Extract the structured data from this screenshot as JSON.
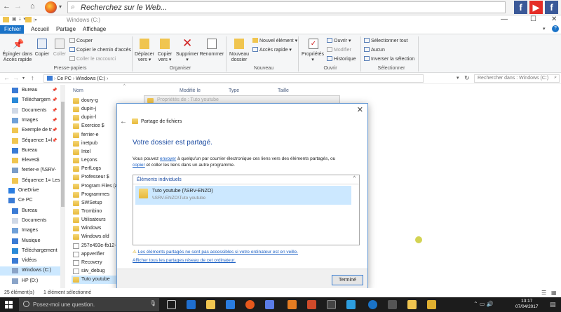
{
  "browser": {
    "search_placeholder": "Recherchez sur le Web...",
    "social": [
      {
        "icon": "facebook-icon",
        "glyph": "f",
        "color": "#3b5998"
      },
      {
        "icon": "youtube-icon",
        "glyph": "▶",
        "color": "#e52d27"
      },
      {
        "icon": "facebook-icon",
        "glyph": "f",
        "color": "#3b5998"
      }
    ]
  },
  "window": {
    "title": "Windows (C:)",
    "min": "—",
    "max": "☐",
    "close": "✕"
  },
  "tabs": [
    "Fichier",
    "Accueil",
    "Partage",
    "Affichage"
  ],
  "ribbon": {
    "pin": "Épingler dans Accès rapide",
    "copy": "Copier",
    "paste": "Coller",
    "cut": "Couper",
    "copy_path": "Copier le chemin d'accès",
    "paste_shortcut": "Coller le raccourci",
    "group_clipboard": "Presse-papiers",
    "move_to": "Déplacer vers ▾",
    "copy_to": "Copier vers ▾",
    "delete": "Supprimer ▾",
    "rename": "Renommer",
    "group_organize": "Organiser",
    "new_folder": "Nouveau dossier",
    "new_item": "Nouvel élément ▾",
    "quick_access": "Accès rapide ▾",
    "group_new": "Nouveau",
    "properties": "Propriétés ▾",
    "open": "Ouvrir ▾",
    "modify": "Modifier",
    "history": "Historique",
    "group_open": "Ouvrir",
    "select_all": "Sélectionner tout",
    "select_none": "Aucun",
    "invert_selection": "Inverser la sélection",
    "group_select": "Sélectionner"
  },
  "address": {
    "path_pc": "Ce PC",
    "path_drive": "Windows (C:)",
    "search_placeholder": "Rechercher dans : Windows (C:)"
  },
  "nav": {
    "items": [
      {
        "label": "Bureau",
        "icon": "desktop-icon",
        "pinned": true
      },
      {
        "label": "Téléchargem",
        "icon": "download-icon",
        "pinned": true
      },
      {
        "label": "Documents",
        "icon": "documents-icon",
        "pinned": true
      },
      {
        "label": "Images",
        "icon": "images-icon",
        "pinned": true
      },
      {
        "label": "Exemple de tr",
        "icon": "folder-icon",
        "pinned": true
      },
      {
        "label": "Séquence 1=l",
        "icon": "folder-icon",
        "pinned": true
      },
      {
        "label": "Bureau",
        "icon": "desktop-icon",
        "pinned": false
      },
      {
        "label": "Eleves$",
        "icon": "folder-icon",
        "pinned": false
      },
      {
        "label": "ferrier-e (\\\\SRV-",
        "icon": "network-drive-icon",
        "pinned": false
      },
      {
        "label": "Séquence 1= Les",
        "icon": "folder-icon",
        "pinned": false
      },
      {
        "label": "OneDrive",
        "icon": "onedrive-icon",
        "pinned": false,
        "level": 1
      },
      {
        "label": "Ce PC",
        "icon": "pc-icon",
        "pinned": false,
        "level": 1
      },
      {
        "label": "Bureau",
        "icon": "desktop-icon",
        "pinned": false
      },
      {
        "label": "Documents",
        "icon": "documents-icon",
        "pinned": false
      },
      {
        "label": "Images",
        "icon": "images-icon",
        "pinned": false
      },
      {
        "label": "Musique",
        "icon": "music-icon",
        "pinned": false
      },
      {
        "label": "Téléchargement",
        "icon": "download-icon",
        "pinned": false
      },
      {
        "label": "Vidéos",
        "icon": "videos-icon",
        "pinned": false
      },
      {
        "label": "Windows (C:)",
        "icon": "drive-icon",
        "pinned": false,
        "selected": true
      },
      {
        "label": "HP (D:)",
        "icon": "drive-icon",
        "pinned": false
      }
    ]
  },
  "columns": [
    "Nom",
    "Modifié le",
    "Type",
    "Taille"
  ],
  "files": [
    {
      "name": "doury-g",
      "kind": "folder"
    },
    {
      "name": "dupin-j",
      "kind": "folder"
    },
    {
      "name": "dupin-l",
      "kind": "folder"
    },
    {
      "name": "Exercice $",
      "kind": "folder"
    },
    {
      "name": "ferrier-e",
      "kind": "folder"
    },
    {
      "name": "inetpub",
      "kind": "folder"
    },
    {
      "name": "Intel",
      "kind": "folder"
    },
    {
      "name": "Leçons",
      "kind": "folder"
    },
    {
      "name": "PerfLogs",
      "kind": "folder"
    },
    {
      "name": "Professeur $",
      "kind": "folder"
    },
    {
      "name": "Program Files (a",
      "kind": "folder"
    },
    {
      "name": "Programmes",
      "kind": "folder"
    },
    {
      "name": "SWSetup",
      "kind": "folder"
    },
    {
      "name": "Trombino",
      "kind": "folder"
    },
    {
      "name": "Utilisateurs",
      "kind": "folder"
    },
    {
      "name": "Windows",
      "kind": "folder"
    },
    {
      "name": "Windows.old",
      "kind": "folder"
    },
    {
      "name": "257e493e-fb12-",
      "kind": "file"
    },
    {
      "name": "appverifier",
      "kind": "file"
    },
    {
      "name": "Recovery",
      "kind": "file"
    },
    {
      "name": "siw_debug",
      "kind": "file"
    },
    {
      "name": "Tuto youtube",
      "kind": "folder",
      "selected": true
    }
  ],
  "prop_dialog": {
    "title": "Propriétés de : Tuto youtube"
  },
  "share_dialog": {
    "header": "Partage de fichiers",
    "heading": "Votre dossier est partagé.",
    "para_1": "Vous pouvez ",
    "link_send": "envoyer",
    "para_2": " à quelqu'un par courrier électronique ces liens vers des éléments partagés, ou",
    "link_copy": "copier",
    "para_3": " et coller les liens dans un autre programme.",
    "list_label": "Éléments individuels",
    "item_title": "Tuto youtube (\\\\SRV-ENZO)",
    "item_path": "\\\\SRV-ENZO\\Tuto youtube",
    "warning": "Les éléments partagés ne sont pas accessibles si votre ordinateur est en veille.",
    "show_all": "Afficher tous les partages réseau de cet ordinateur.",
    "done": "Terminé"
  },
  "status": {
    "count": "25 élément(s)",
    "selected": "1 élément sélectionné"
  },
  "taskbar": {
    "search_placeholder": "Posez-moi une question.",
    "time": "13:17",
    "date": "07/04/2017"
  }
}
